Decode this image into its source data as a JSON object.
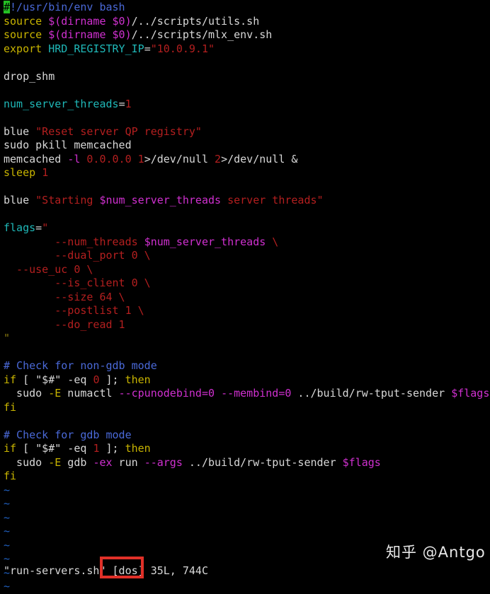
{
  "editor": {
    "app": "vim",
    "background_color": "#000000",
    "cursor_color": "#24c024",
    "filename": "run-servers.sh"
  },
  "code_lines": [
    {
      "id": "line-1",
      "tokens": [
        {
          "t": "#",
          "c": "cursor"
        },
        {
          "t": "!/usr/bin/env bash",
          "c": "c-cmt"
        }
      ]
    },
    {
      "id": "line-2",
      "tokens": [
        {
          "t": "source ",
          "c": "c-kw"
        },
        {
          "t": "$(dirname $0)",
          "c": "c-var"
        },
        {
          "t": "/../scripts/utils.sh",
          "c": "c-plain"
        }
      ]
    },
    {
      "id": "line-3",
      "tokens": [
        {
          "t": "source ",
          "c": "c-kw"
        },
        {
          "t": "$(dirname $0)",
          "c": "c-var"
        },
        {
          "t": "/../scripts/mlx_env.sh",
          "c": "c-plain"
        }
      ]
    },
    {
      "id": "line-4",
      "tokens": [
        {
          "t": "export ",
          "c": "c-kw"
        },
        {
          "t": "HRD_REGISTRY_IP",
          "c": "c-ident"
        },
        {
          "t": "=",
          "c": "c-plain"
        },
        {
          "t": "\"10.0.9.1\"",
          "c": "c-str"
        }
      ]
    },
    {
      "id": "line-5",
      "tokens": []
    },
    {
      "id": "line-6",
      "tokens": [
        {
          "t": "drop_shm",
          "c": "c-plain"
        }
      ]
    },
    {
      "id": "line-7",
      "tokens": []
    },
    {
      "id": "line-8",
      "tokens": [
        {
          "t": "num_server_threads",
          "c": "c-ident"
        },
        {
          "t": "=",
          "c": "c-plain"
        },
        {
          "t": "1",
          "c": "c-num"
        }
      ]
    },
    {
      "id": "line-9",
      "tokens": []
    },
    {
      "id": "line-10",
      "tokens": [
        {
          "t": "blue ",
          "c": "c-plain"
        },
        {
          "t": "\"Reset server QP registry\"",
          "c": "c-str"
        }
      ]
    },
    {
      "id": "line-11",
      "tokens": [
        {
          "t": "sudo pkill memcached",
          "c": "c-plain"
        }
      ]
    },
    {
      "id": "line-12",
      "tokens": [
        {
          "t": "memcached ",
          "c": "c-plain"
        },
        {
          "t": "-l",
          "c": "c-var"
        },
        {
          "t": " ",
          "c": "c-plain"
        },
        {
          "t": "0.0.0.0",
          "c": "c-num"
        },
        {
          "t": " ",
          "c": "c-plain"
        },
        {
          "t": "1",
          "c": "c-num"
        },
        {
          "t": ">/dev/null ",
          "c": "c-plain"
        },
        {
          "t": "2",
          "c": "c-num"
        },
        {
          "t": ">/dev/null &",
          "c": "c-plain"
        }
      ]
    },
    {
      "id": "line-13",
      "tokens": [
        {
          "t": "sleep ",
          "c": "c-kw"
        },
        {
          "t": "1",
          "c": "c-num"
        }
      ]
    },
    {
      "id": "line-14",
      "tokens": []
    },
    {
      "id": "line-15",
      "tokens": [
        {
          "t": "blue ",
          "c": "c-plain"
        },
        {
          "t": "\"Starting ",
          "c": "c-str"
        },
        {
          "t": "$num_server_threads",
          "c": "c-var"
        },
        {
          "t": " server threads\"",
          "c": "c-str"
        }
      ]
    },
    {
      "id": "line-16",
      "tokens": []
    },
    {
      "id": "line-17",
      "tokens": [
        {
          "t": "flags",
          "c": "c-ident"
        },
        {
          "t": "=",
          "c": "c-plain"
        },
        {
          "t": "\"",
          "c": "c-str"
        }
      ]
    },
    {
      "id": "line-18",
      "tokens": [
        {
          "t": "        --num_threads ",
          "c": "c-str"
        },
        {
          "t": "$num_server_threads",
          "c": "c-var"
        },
        {
          "t": " \\",
          "c": "c-str"
        }
      ]
    },
    {
      "id": "line-19",
      "tokens": [
        {
          "t": "        --dual_port 0 \\",
          "c": "c-str"
        }
      ]
    },
    {
      "id": "line-20",
      "tokens": [
        {
          "t": "  --use_uc 0 \\",
          "c": "c-str"
        }
      ]
    },
    {
      "id": "line-21",
      "tokens": [
        {
          "t": "        --is_client 0 \\",
          "c": "c-str"
        }
      ]
    },
    {
      "id": "line-22",
      "tokens": [
        {
          "t": "        --size 64 \\",
          "c": "c-str"
        }
      ]
    },
    {
      "id": "line-23",
      "tokens": [
        {
          "t": "        --postlist 1 \\",
          "c": "c-str"
        }
      ]
    },
    {
      "id": "line-24",
      "tokens": [
        {
          "t": "        --do_read 1",
          "c": "c-str"
        }
      ]
    },
    {
      "id": "line-25",
      "tokens": [
        {
          "t": "\"",
          "c": "c-dimq"
        }
      ]
    },
    {
      "id": "line-26",
      "tokens": []
    },
    {
      "id": "line-27",
      "tokens": [
        {
          "t": "# Check for non-gdb mode",
          "c": "c-cmt"
        }
      ]
    },
    {
      "id": "line-28",
      "tokens": [
        {
          "t": "if",
          "c": "c-kw"
        },
        {
          "t": " [ ",
          "c": "c-plain"
        },
        {
          "t": "\"$#\"",
          "c": "c-plain"
        },
        {
          "t": " -eq ",
          "c": "c-plain"
        },
        {
          "t": "0",
          "c": "c-num"
        },
        {
          "t": " ]; ",
          "c": "c-plain"
        },
        {
          "t": "then",
          "c": "c-kw"
        }
      ]
    },
    {
      "id": "line-29",
      "tokens": [
        {
          "t": "  sudo ",
          "c": "c-plain"
        },
        {
          "t": "-E",
          "c": "c-kw"
        },
        {
          "t": " numactl ",
          "c": "c-plain"
        },
        {
          "t": "--cpunodebind=0",
          "c": "c-var"
        },
        {
          "t": " ",
          "c": "c-plain"
        },
        {
          "t": "--membind=0",
          "c": "c-var"
        },
        {
          "t": " ../build/rw-tput-sender ",
          "c": "c-plain"
        },
        {
          "t": "$flags",
          "c": "c-var"
        }
      ]
    },
    {
      "id": "line-30",
      "tokens": [
        {
          "t": "fi",
          "c": "c-kw"
        }
      ]
    },
    {
      "id": "line-31",
      "tokens": []
    },
    {
      "id": "line-32",
      "tokens": [
        {
          "t": "# Check for gdb mode",
          "c": "c-cmt"
        }
      ]
    },
    {
      "id": "line-33",
      "tokens": [
        {
          "t": "if",
          "c": "c-kw"
        },
        {
          "t": " [ ",
          "c": "c-plain"
        },
        {
          "t": "\"$#\"",
          "c": "c-plain"
        },
        {
          "t": " -eq ",
          "c": "c-plain"
        },
        {
          "t": "1",
          "c": "c-num"
        },
        {
          "t": " ]; ",
          "c": "c-plain"
        },
        {
          "t": "then",
          "c": "c-kw"
        }
      ]
    },
    {
      "id": "line-34",
      "tokens": [
        {
          "t": "  sudo ",
          "c": "c-plain"
        },
        {
          "t": "-E",
          "c": "c-kw"
        },
        {
          "t": " gdb ",
          "c": "c-plain"
        },
        {
          "t": "-ex",
          "c": "c-var"
        },
        {
          "t": " run ",
          "c": "c-plain"
        },
        {
          "t": "--args",
          "c": "c-var"
        },
        {
          "t": " ../build/rw-tput-sender ",
          "c": "c-plain"
        },
        {
          "t": "$flags",
          "c": "c-var"
        }
      ]
    },
    {
      "id": "line-35",
      "tokens": [
        {
          "t": "fi",
          "c": "c-kw"
        }
      ]
    },
    {
      "id": "tilde-1",
      "tokens": [
        {
          "t": "~",
          "c": "c-tilde"
        }
      ]
    },
    {
      "id": "tilde-2",
      "tokens": [
        {
          "t": "~",
          "c": "c-tilde"
        }
      ]
    },
    {
      "id": "tilde-3",
      "tokens": [
        {
          "t": "~",
          "c": "c-tilde"
        }
      ]
    },
    {
      "id": "tilde-4",
      "tokens": [
        {
          "t": "~",
          "c": "c-tilde"
        }
      ]
    },
    {
      "id": "tilde-5",
      "tokens": [
        {
          "t": "~",
          "c": "c-tilde"
        }
      ]
    },
    {
      "id": "tilde-6",
      "tokens": [
        {
          "t": "~",
          "c": "c-tilde"
        }
      ]
    },
    {
      "id": "tilde-7",
      "tokens": [
        {
          "t": "~",
          "c": "c-tilde"
        }
      ]
    },
    {
      "id": "tilde-8",
      "tokens": [
        {
          "t": "~",
          "c": "c-tilde"
        }
      ]
    }
  ],
  "status_bar": {
    "filename_quoted": "\"run-servers.sh\"",
    "fileformat": "[dos]",
    "line_count": "35L,",
    "char_count": "744C",
    "full_text": "\"run-servers.sh\" [dos] 35L, 744C"
  },
  "annotation": {
    "target": "[dos]",
    "color": "#e03028",
    "shape": "rectangle"
  },
  "watermark": {
    "text": "知乎 @Antgo"
  }
}
